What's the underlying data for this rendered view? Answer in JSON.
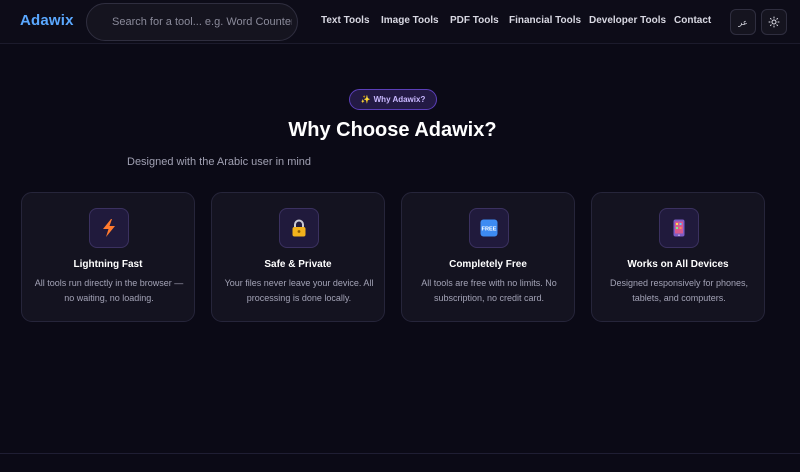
{
  "navbar": {
    "logo": "Adawix",
    "search_placeholder": "Search for a tool... e.g. Word Counter",
    "links": [
      "Text Tools",
      "Image Tools",
      "PDF Tools",
      "Financial Tools",
      "Developer Tools",
      "Contact"
    ],
    "lang_label": "عر",
    "theme_icon": "sun-icon"
  },
  "hero": {
    "badge": "Why Adawix?",
    "badge_icon": "sparkles-icon",
    "title": "Why Choose Adawix?",
    "subtitle": "Designed with the Arabic user in mind"
  },
  "features": [
    {
      "icon": "lightning-icon",
      "title": "Lightning Fast",
      "desc": "All tools run directly in the browser — no waiting, no loading."
    },
    {
      "icon": "lock-icon",
      "title": "Safe & Private",
      "desc": "Your files never leave your device. All processing is done locally."
    },
    {
      "icon": "free-icon",
      "icon_text": "FREE",
      "title": "Completely Free",
      "desc": "All tools are free with no limits. No subscription, no credit card."
    },
    {
      "icon": "mobile-phone-icon",
      "title": "Works on All Devices",
      "desc": "Designed responsively for phones, tablets, and computers."
    }
  ],
  "colors": {
    "background": "#0b0a16",
    "accent": "#5aa8ff",
    "badge_border": "#5b3fb8",
    "card_bg": "#141320"
  }
}
